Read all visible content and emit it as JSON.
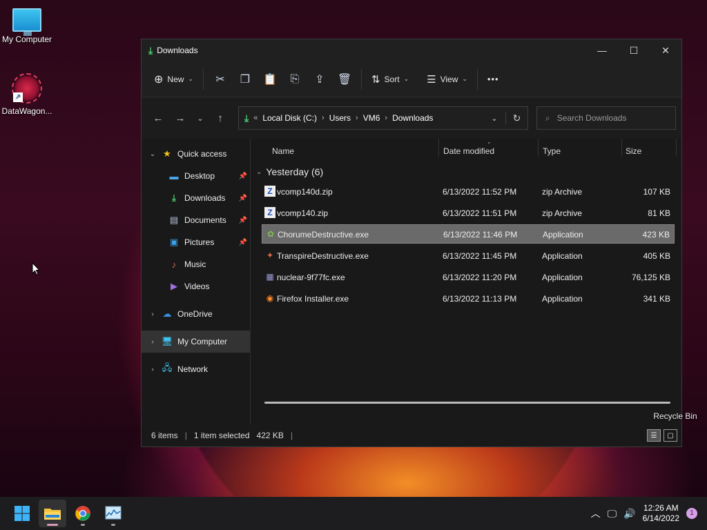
{
  "desktop": {
    "icons": [
      {
        "label": "My Computer",
        "icon": "monitor-icon"
      },
      {
        "label": "DataWagon...",
        "icon": "datawagon-icon"
      },
      {
        "label": "Recycle Bin",
        "icon": "recycle-bin-icon"
      }
    ]
  },
  "window": {
    "title": "Downloads",
    "toolbar": {
      "new_label": "New",
      "sort_label": "Sort",
      "view_label": "View",
      "more_label": "•••"
    },
    "address": {
      "prefix": "«",
      "crumbs": [
        "Local Disk (C:)",
        "Users",
        "VM6",
        "Downloads"
      ],
      "search_placeholder": "Search Downloads"
    },
    "nav": {
      "quick_access": "Quick access",
      "items": [
        {
          "label": "Desktop",
          "pinned": true
        },
        {
          "label": "Downloads",
          "pinned": true
        },
        {
          "label": "Documents",
          "pinned": true
        },
        {
          "label": "Pictures",
          "pinned": true
        },
        {
          "label": "Music",
          "pinned": false
        },
        {
          "label": "Videos",
          "pinned": false
        }
      ],
      "onedrive": "OneDrive",
      "my_computer": "My Computer",
      "network": "Network"
    },
    "columns": {
      "name": "Name",
      "date": "Date modified",
      "type": "Type",
      "size": "Size"
    },
    "group": "Yesterday (6)",
    "files": [
      {
        "name": "vcomp140d.zip",
        "date": "6/13/2022 11:52 PM",
        "type": "zip Archive",
        "size": "107 KB"
      },
      {
        "name": "vcomp140.zip",
        "date": "6/13/2022 11:51 PM",
        "type": "zip Archive",
        "size": "81 KB"
      },
      {
        "name": "ChorumeDestructive.exe",
        "date": "6/13/2022 11:46 PM",
        "type": "Application",
        "size": "423 KB",
        "selected": true
      },
      {
        "name": "TranspireDestructive.exe",
        "date": "6/13/2022 11:45 PM",
        "type": "Application",
        "size": "405 KB"
      },
      {
        "name": "nuclear-9f77fc.exe",
        "date": "6/13/2022 11:20 PM",
        "type": "Application",
        "size": "76,125 KB"
      },
      {
        "name": "Firefox Installer.exe",
        "date": "6/13/2022 11:13 PM",
        "type": "Application",
        "size": "341 KB"
      }
    ],
    "status": {
      "items": "6 items",
      "selected": "1 item selected",
      "selected_size": "422 KB",
      "trailing_sep": "|"
    }
  },
  "taskbar": {
    "time": "12:26 AM",
    "date": "6/14/2022",
    "notifications": "1"
  }
}
